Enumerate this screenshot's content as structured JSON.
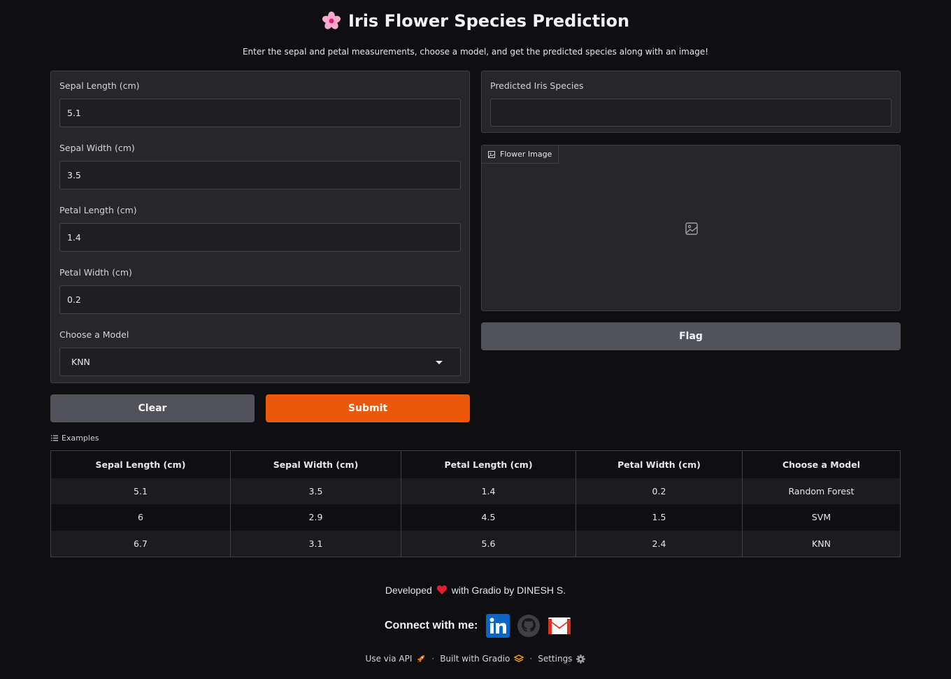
{
  "header": {
    "title": "Iris Flower Species Prediction",
    "subtitle": "Enter the sepal and petal measurements, choose a model, and get the predicted species along with an image!"
  },
  "inputs": {
    "sepal_length": {
      "label": "Sepal Length (cm)",
      "value": "5.1"
    },
    "sepal_width": {
      "label": "Sepal Width (cm)",
      "value": "3.5"
    },
    "petal_length": {
      "label": "Petal Length (cm)",
      "value": "1.4"
    },
    "petal_width": {
      "label": "Petal Width (cm)",
      "value": "0.2"
    },
    "model": {
      "label": "Choose a Model",
      "value": "KNN"
    }
  },
  "buttons": {
    "clear": "Clear",
    "submit": "Submit",
    "flag": "Flag"
  },
  "outputs": {
    "species_label": "Predicted Iris Species",
    "species_value": "",
    "image_label": "Flower Image"
  },
  "examples": {
    "label": "Examples",
    "headers": [
      "Sepal Length (cm)",
      "Sepal Width (cm)",
      "Petal Length (cm)",
      "Petal Width (cm)",
      "Choose a Model"
    ],
    "rows": [
      [
        "5.1",
        "3.5",
        "1.4",
        "0.2",
        "Random Forest"
      ],
      [
        "6",
        "2.9",
        "4.5",
        "1.5",
        "SVM"
      ],
      [
        "6.7",
        "3.1",
        "5.6",
        "2.4",
        "KNN"
      ]
    ]
  },
  "footer": {
    "developed_prefix": "Developed",
    "developed_suffix": "with Gradio by DINESH S.",
    "connect_label": "Connect with me:",
    "social_icons": [
      "linkedin-icon",
      "github-icon",
      "gmail-icon"
    ],
    "use_api": "Use via API",
    "built_with": "Built with Gradio",
    "settings": "Settings",
    "separator": "·"
  },
  "colors": {
    "accent": "#ea580c",
    "background": "#0f0f11",
    "panel": "#27272a"
  }
}
